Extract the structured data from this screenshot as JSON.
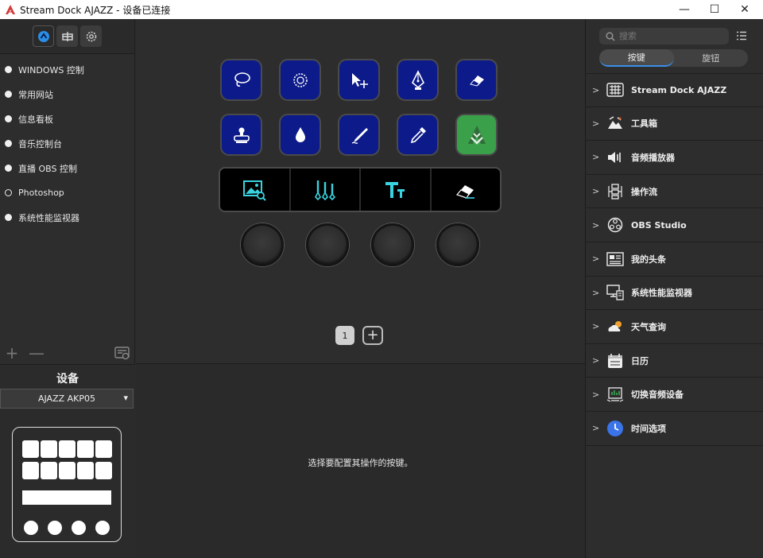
{
  "window": {
    "title": "Stream Dock AJAZZ - 设备已连接",
    "minimize": "—",
    "maximize": "☐",
    "close": "✕"
  },
  "profiles": [
    {
      "label": "WINDOWS 控制",
      "active": false
    },
    {
      "label": "常用网站",
      "active": false
    },
    {
      "label": "信息看板",
      "active": false
    },
    {
      "label": "音乐控制台",
      "active": false
    },
    {
      "label": "直播 OBS 控制",
      "active": false
    },
    {
      "label": "Photoshop",
      "active": true
    },
    {
      "label": "系统性能监视器",
      "active": false
    }
  ],
  "profile_tools": {
    "add": "+",
    "remove": "—"
  },
  "device": {
    "title": "设备",
    "selected": "AJAZZ AKP05"
  },
  "keys": [
    {
      "icon": "lasso-icon",
      "color": "#0d1b8a"
    },
    {
      "icon": "quick-select-icon",
      "color": "#0d1b8a"
    },
    {
      "icon": "move-tool-icon",
      "color": "#0d1b8a"
    },
    {
      "icon": "pen-tool-icon",
      "color": "#0d1b8a"
    },
    {
      "icon": "eraser-icon",
      "color": "#0d1b8a"
    },
    {
      "icon": "stamp-icon",
      "color": "#0d1b8a"
    },
    {
      "icon": "blur-drop-icon",
      "color": "#0d1b8a"
    },
    {
      "icon": "smudge-icon",
      "color": "#0d1b8a"
    },
    {
      "icon": "eyedropper-icon",
      "color": "#0d1b8a"
    },
    {
      "icon": "ajazz-logo-icon",
      "color": "#3aa04a"
    }
  ],
  "touch_strip": [
    {
      "icon": "image-search-icon"
    },
    {
      "icon": "brush-set-icon"
    },
    {
      "icon": "text-tool-icon"
    },
    {
      "icon": "eraser-icon"
    }
  ],
  "pager": {
    "current": "1",
    "add": "+"
  },
  "properties": {
    "message": "选择要配置其操作的按键。"
  },
  "search": {
    "placeholder": "搜索"
  },
  "tabs": {
    "keys": "按键",
    "knobs": "旋钮"
  },
  "categories": [
    {
      "label": "Stream Dock AJAZZ",
      "icon": "keyboard-grid-icon"
    },
    {
      "label": "工具箱",
      "icon": "toolbox-icon"
    },
    {
      "label": "音频播放器",
      "icon": "speaker-icon"
    },
    {
      "label": "操作流",
      "icon": "workflow-icon"
    },
    {
      "label": "OBS Studio",
      "icon": "obs-icon"
    },
    {
      "label": "我的头条",
      "icon": "newspaper-icon"
    },
    {
      "label": "系统性能监视器",
      "icon": "monitor-icon"
    },
    {
      "label": "天气查询",
      "icon": "weather-icon"
    },
    {
      "label": "日历",
      "icon": "calendar-icon"
    },
    {
      "label": "切换音频设备",
      "icon": "audio-device-icon"
    },
    {
      "label": "时间选项",
      "icon": "clock-icon"
    }
  ],
  "colors": {
    "accent": "#3a8ee8",
    "key_blue": "#0d1b8a",
    "key_green": "#3aa04a",
    "lcd_icon": "#39d3e0"
  }
}
